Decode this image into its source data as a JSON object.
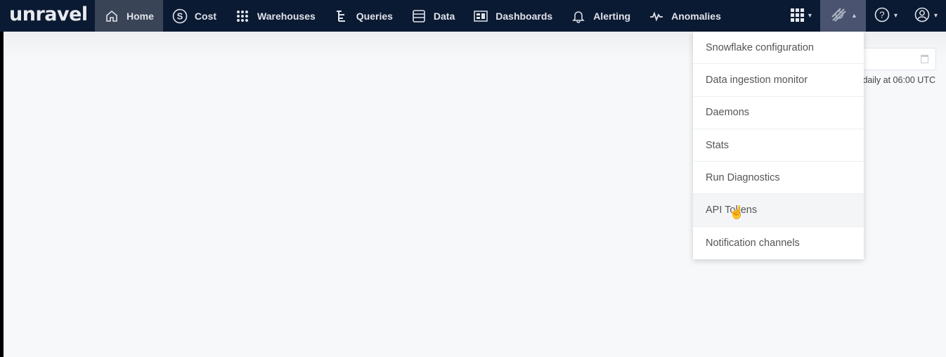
{
  "brand": "unravel",
  "nav": [
    {
      "label": "Home",
      "icon": "home-icon",
      "active": true
    },
    {
      "label": "Cost",
      "icon": "dollar-circle-icon"
    },
    {
      "label": "Warehouses",
      "icon": "grid-dots-icon"
    },
    {
      "label": "Queries",
      "icon": "tree-icon"
    },
    {
      "label": "Data",
      "icon": "database-icon"
    },
    {
      "label": "Dashboards",
      "icon": "dashboard-icon"
    },
    {
      "label": "Alerting",
      "icon": "bell-icon"
    },
    {
      "label": "Anomalies",
      "icon": "pulse-icon"
    }
  ],
  "right_icons": [
    "apps-grid-icon",
    "settings-icon",
    "help-icon",
    "user-icon"
  ],
  "schedule_text": "daily at 06:00 UTC",
  "settings_menu": [
    "Snowflake configuration",
    "Data ingestion monitor",
    "Daemons",
    "Stats",
    "Run Diagnostics",
    "API Tokens",
    "Notification channels"
  ],
  "hovered_item": "API Tokens",
  "colors": {
    "nav_bg": "#0b1a33",
    "active_bg": "#3a4457"
  }
}
